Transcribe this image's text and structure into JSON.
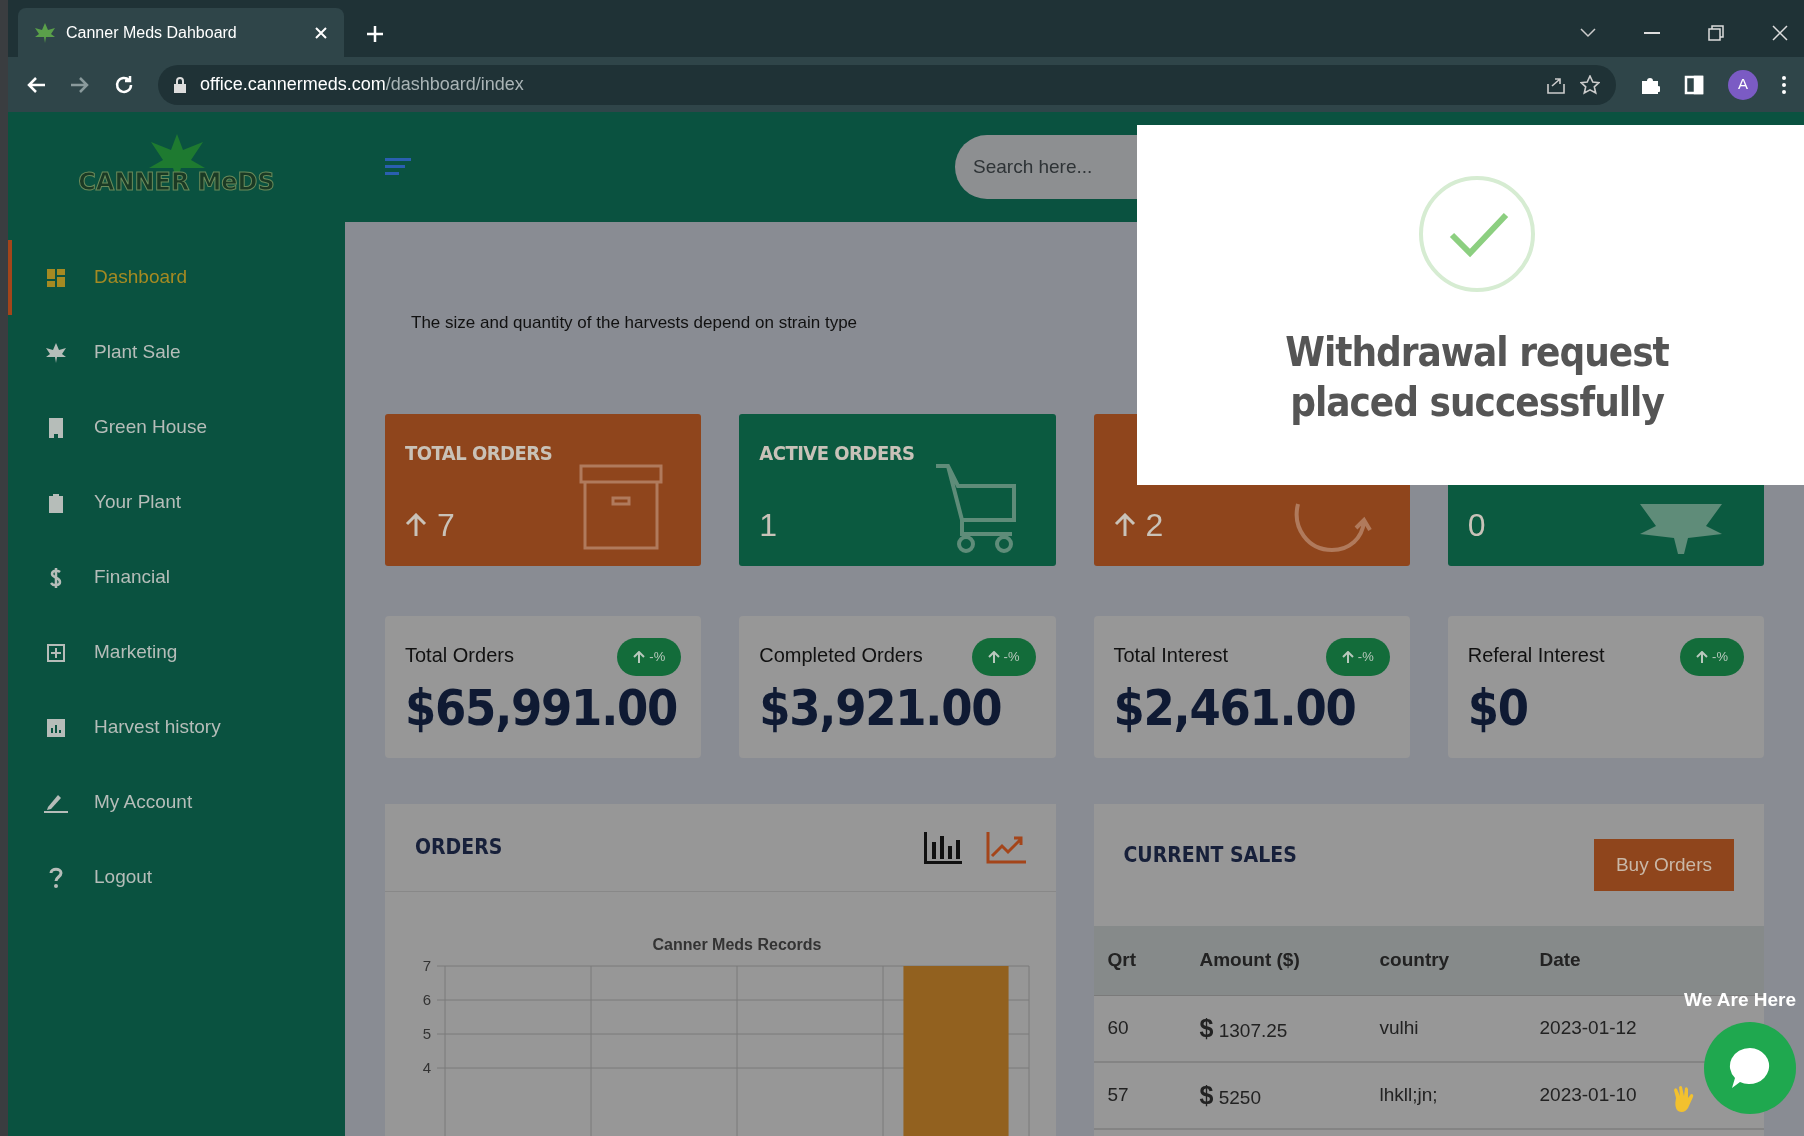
{
  "browser": {
    "tab_title": "Canner Meds Dahboard",
    "url_host": "office.cannermeds.com",
    "url_path": "/dashboard/index",
    "profile": "A"
  },
  "sidebar": {
    "logo_left": "CANNER",
    "logo_right": "MeDS",
    "items": [
      {
        "label": "Dashboard",
        "selected": true
      },
      {
        "label": "Plant Sale",
        "selected": false
      },
      {
        "label": "Green House",
        "selected": false
      },
      {
        "label": "Your Plant",
        "selected": false
      },
      {
        "label": "Financial",
        "selected": false
      },
      {
        "label": "Marketing",
        "selected": false
      },
      {
        "label": "Harvest history",
        "selected": false
      },
      {
        "label": "My Account",
        "selected": false
      },
      {
        "label": "Logout",
        "selected": false
      }
    ]
  },
  "header": {
    "search": {
      "placeholder": "Search here..."
    }
  },
  "intro": "The size and quantity of the harvests depend on strain type",
  "summary_cards": [
    {
      "title": "TOTAL ORDERS",
      "value": "7",
      "arrow": true,
      "color": "#8f451c"
    },
    {
      "title": "ACTIVE ORDERS",
      "value": "1",
      "arrow": false,
      "color": "#0b5a40"
    },
    {
      "value": "2",
      "arrow": true,
      "color": "#8f451c"
    },
    {
      "value": "0",
      "arrow": false,
      "color": "#0b5a40"
    }
  ],
  "stat_cards": [
    {
      "label": "Total Orders",
      "amount": "$65,991.00",
      "badge": "-%"
    },
    {
      "label": "Completed Orders",
      "amount": "$3,921.00",
      "badge": "-%"
    },
    {
      "label": "Total Interest",
      "amount": "$2,461.00",
      "badge": "-%"
    },
    {
      "label": "Referal Interest",
      "amount": "$0",
      "badge": "-%"
    }
  ],
  "orders_panel": {
    "title": "ORDERS",
    "chart_data": {
      "type": "bar",
      "title": "Canner Meds Records",
      "values": [
        null,
        null,
        null,
        7
      ],
      "yticks": [
        4,
        5,
        6,
        7
      ],
      "ylim": [
        0,
        7
      ],
      "grid": true
    }
  },
  "sales_panel": {
    "title": "CURRENT SALES",
    "button": "Buy Orders",
    "columns": [
      "Qrt",
      "Amount ($)",
      "country",
      "Date"
    ],
    "rows": [
      [
        "60",
        "**$** 1307.25",
        "vulhi",
        "2023-01-12"
      ],
      [
        "57",
        "**$** 5250",
        "lhkll;jn;",
        "2023-01-10"
      ]
    ]
  },
  "modal": {
    "message": "Withdrawal request placed successfully"
  },
  "chat_widget": {
    "label": "We Are Here"
  }
}
